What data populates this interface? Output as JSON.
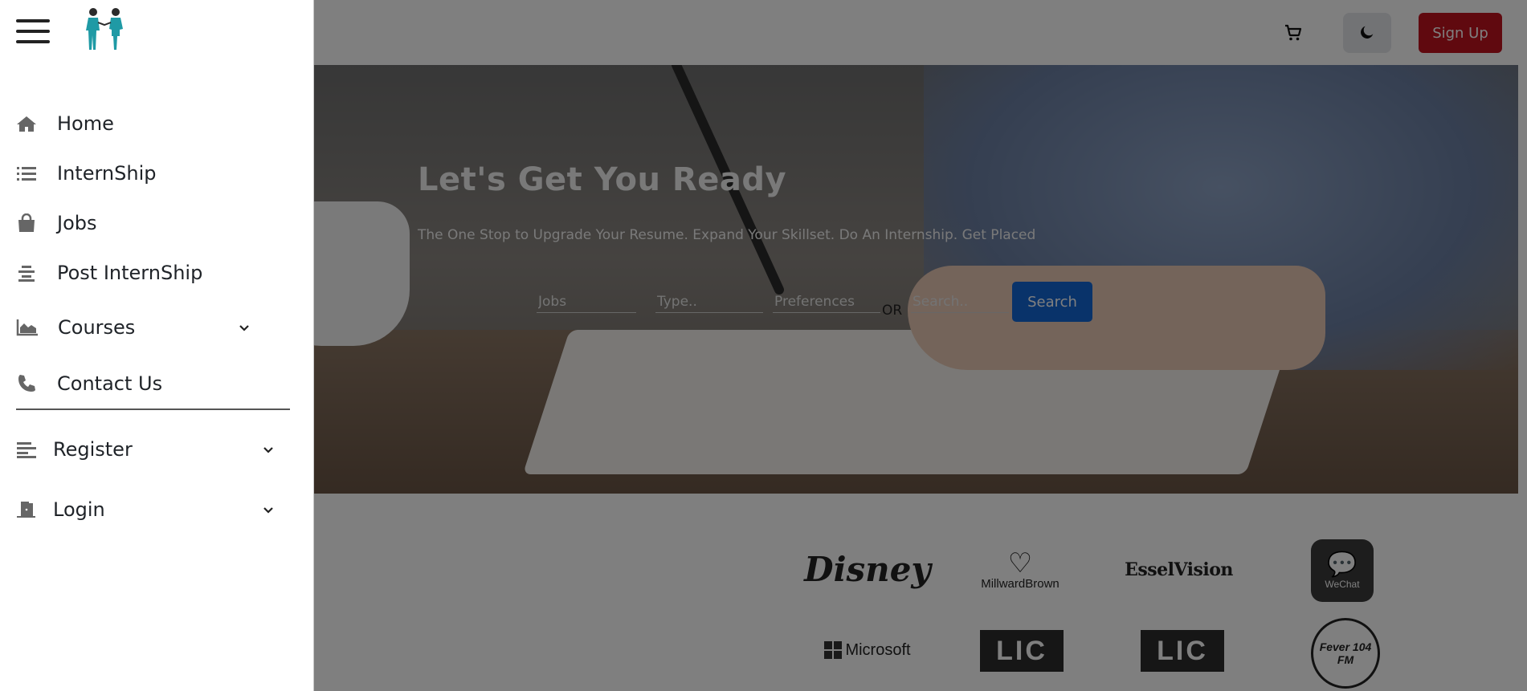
{
  "header": {
    "cart_icon": "shopping-cart-icon",
    "theme_icon": "moon-icon",
    "signup_label": "Sign Up",
    "signup_color": "#c1121f"
  },
  "hero": {
    "title": "Let's Get You Ready",
    "subtitle": "The One Stop to Upgrade Your Resume. Expand Your Skillset. Do An Internship. Get Placed",
    "search": {
      "field1_placeholder": "Jobs",
      "field2_placeholder": "Type..",
      "field3_placeholder": "Preferences",
      "or_label": "OR",
      "field4_placeholder": "Search..",
      "button_label": "Search",
      "button_color": "#1266d4"
    }
  },
  "logos": {
    "disney": "Disney",
    "millward_brown": "MillwardBrown",
    "essel_vision": "EsselVision",
    "wechat": "WeChat",
    "microsoft": "Microsoft",
    "lic_1": "LIC",
    "lic_2": "LIC",
    "fever": "Fever 104 FM"
  },
  "sidebar": {
    "menu_icon": "hamburger-menu-icon",
    "items": [
      {
        "label": "Home",
        "icon": "home-icon"
      },
      {
        "label": "InternShip",
        "icon": "list-icon"
      },
      {
        "label": "Jobs",
        "icon": "shopping-bag-icon"
      },
      {
        "label": "Post InternShip",
        "icon": "align-center-icon"
      },
      {
        "label": "Courses",
        "icon": "area-chart-icon",
        "expandable": true
      },
      {
        "label": "Contact Us",
        "icon": "phone-icon"
      },
      {
        "label": "Register",
        "icon": "align-left-icon",
        "expandable": true
      },
      {
        "label": "Login",
        "icon": "door-open-icon",
        "expandable": true
      }
    ]
  }
}
